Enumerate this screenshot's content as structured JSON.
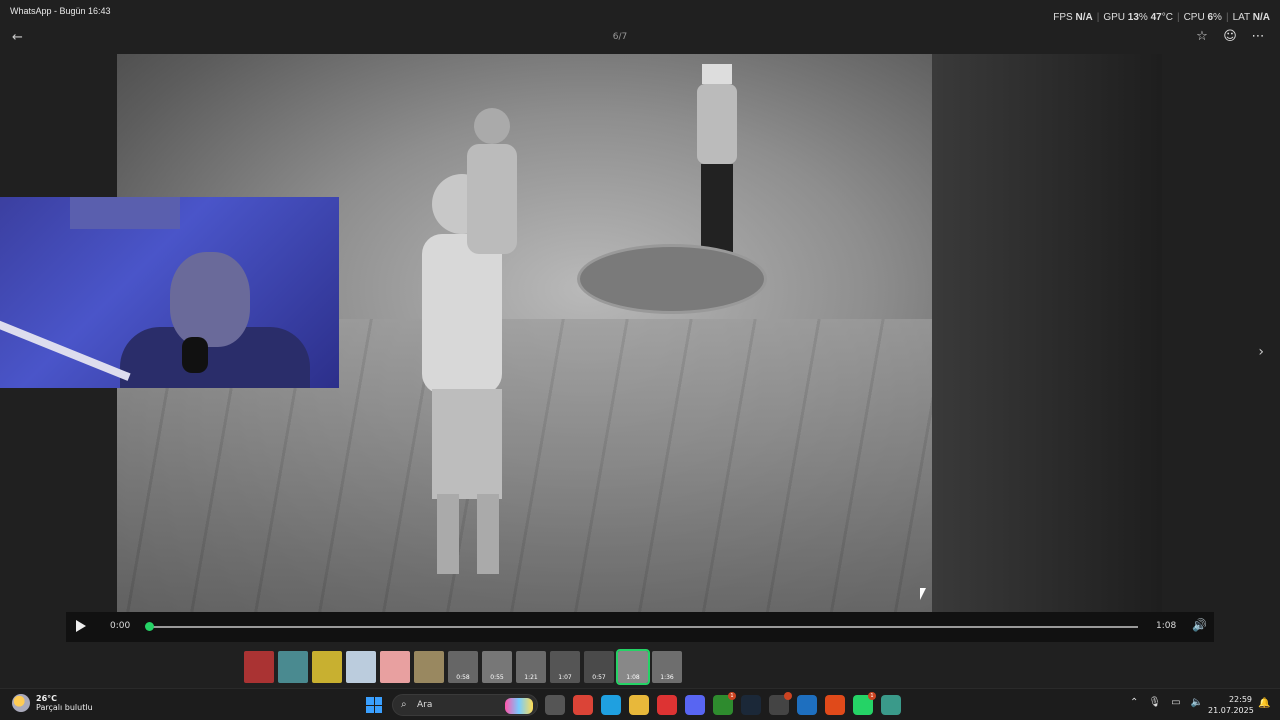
{
  "titlebar": {
    "title": "WhatsApp - Bugün 16:43"
  },
  "overlay": {
    "fps_label": "FPS",
    "fps_value": "N/A",
    "gpu_label": "GPU",
    "gpu_value": "13",
    "gpu_unit": "%",
    "gpu_temp": "47",
    "gpu_temp_unit": "°C",
    "cpu_label": "CPU",
    "cpu_value": "6",
    "cpu_unit": "%",
    "lat_label": "LAT",
    "lat_value": "N/A"
  },
  "viewer": {
    "counter": "6/7",
    "back_icon": "arrow-left-icon",
    "star_icon": "star-icon",
    "emoji_icon": "emoji-icon",
    "more_icon": "more-icon",
    "next_icon": "chevron-right-icon"
  },
  "player": {
    "current_time": "0:00",
    "total_time": "1:08",
    "progress": 0
  },
  "thumbnails": [
    {
      "duration": "",
      "color": "#a33"
    },
    {
      "duration": "",
      "color": "#4a8a90"
    },
    {
      "duration": "",
      "color": "#c8b030"
    },
    {
      "duration": "",
      "color": "#bcd"
    },
    {
      "duration": "",
      "color": "#e8a0a0"
    },
    {
      "duration": "",
      "color": "#998860"
    },
    {
      "duration": "0:58",
      "color": "#666"
    },
    {
      "duration": "0:55",
      "color": "#777"
    },
    {
      "duration": "1:21",
      "color": "#6a6a6a"
    },
    {
      "duration": "1:07",
      "color": "#555"
    },
    {
      "duration": "0:57",
      "color": "#4a4a4a"
    },
    {
      "duration": "1:08",
      "color": "#888",
      "active": true
    },
    {
      "duration": "1:36",
      "color": "#6e6e6e"
    }
  ],
  "taskbar": {
    "weather_temp": "26°C",
    "weather_desc": "Parçalı bulutlu",
    "search_label": "Ara",
    "time": "22:59",
    "date": "21.07.2025",
    "apps": [
      {
        "name": "task-view-icon",
        "color": "#555"
      },
      {
        "name": "chrome-icon",
        "color": "#db4437"
      },
      {
        "name": "edge-icon",
        "color": "#1fa0e0"
      },
      {
        "name": "file-explorer-icon",
        "color": "#e8b83a"
      },
      {
        "name": "opera-gx-icon",
        "color": "#d33"
      },
      {
        "name": "discord-icon",
        "color": "#5865f2"
      },
      {
        "name": "xbox-icon",
        "color": "#2e8b2e",
        "badge": "1"
      },
      {
        "name": "steam-icon",
        "color": "#1b2838"
      },
      {
        "name": "app-icon-red-dot",
        "color": "#444",
        "badge": ""
      },
      {
        "name": "vpn-icon",
        "color": "#1e6fbf"
      },
      {
        "name": "ea-icon",
        "color": "#e04a1a"
      },
      {
        "name": "whatsapp-icon",
        "color": "#25d366",
        "badge": "1"
      },
      {
        "name": "globe-icon",
        "color": "#3a9a8a"
      }
    ]
  },
  "colors": {
    "accent": "#25d366",
    "background": "#202020"
  }
}
